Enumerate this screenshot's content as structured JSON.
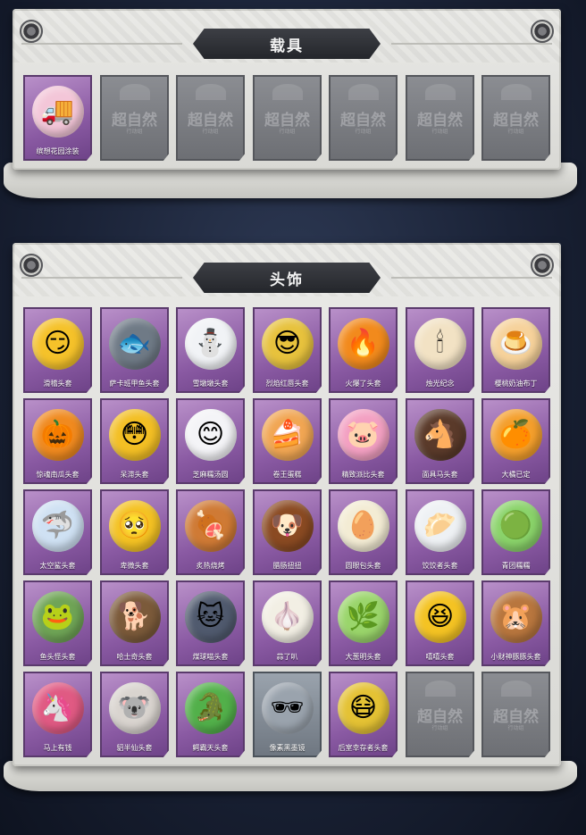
{
  "vehicle_section": {
    "title": "载具",
    "items": [
      {
        "label": "缤想花园涂装",
        "icon": "pink-truck-icon",
        "glyph": "🚚",
        "color": "#f3c6d8"
      }
    ],
    "empty_watermark": "超自然",
    "empty_sub": "行动组",
    "empty_slots": 6
  },
  "head_section": {
    "title": "头饰",
    "items": [
      {
        "label": "滑稽头套",
        "icon": "funny-face-icon",
        "glyph": "😏",
        "color": "#f5c22a"
      },
      {
        "label": "萨卡班甲鱼头套",
        "icon": "fish-head-icon",
        "glyph": "🐟",
        "color": "#6f7a86"
      },
      {
        "label": "雪墩墩头套",
        "icon": "snowman-icon",
        "glyph": "⛄",
        "color": "#f1f3f6"
      },
      {
        "label": "烈焰红唇头套",
        "icon": "sunglasses-pikachu-icon",
        "glyph": "😎",
        "color": "#e7c23d"
      },
      {
        "label": "火爆了头套",
        "icon": "fire-spirit-icon",
        "glyph": "🔥",
        "color": "#f28a1c"
      },
      {
        "label": "烛光纪念",
        "icon": "candle-icon",
        "glyph": "🕯",
        "color": "#f2e2c4"
      },
      {
        "label": "樱桃奶油布丁",
        "icon": "pudding-icon",
        "glyph": "🍮",
        "color": "#f6d29b"
      },
      {
        "label": "惊魂南瓜头套",
        "icon": "pumpkin-icon",
        "glyph": "🎃",
        "color": "#f08a1f"
      },
      {
        "label": "呆滞头套",
        "icon": "dazed-face-icon",
        "glyph": "😳",
        "color": "#f3bf24"
      },
      {
        "label": "芝麻糯汤圆",
        "icon": "rice-ball-icon",
        "glyph": "😊",
        "color": "#f4f4f7"
      },
      {
        "label": "卷王蛋糕",
        "icon": "cake-roll-icon",
        "glyph": "🍰",
        "color": "#f1a653"
      },
      {
        "label": "精致派比头套",
        "icon": "pink-pig-icon",
        "glyph": "🐷",
        "color": "#f3a0c2"
      },
      {
        "label": "面具马头套",
        "icon": "horse-head-icon",
        "glyph": "🐴",
        "color": "#5a3a2a"
      },
      {
        "label": "大橘已定",
        "icon": "orange-icon",
        "glyph": "🍊",
        "color": "#f49f2c"
      },
      {
        "label": "太空鲨头套",
        "icon": "shark-icon",
        "glyph": "🦈",
        "color": "#cfe1f3"
      },
      {
        "label": "卑微头套",
        "icon": "humble-face-icon",
        "glyph": "🥺",
        "color": "#f4c223"
      },
      {
        "label": "炙热烧烤",
        "icon": "bbq-icon",
        "glyph": "🍖",
        "color": "#cf7a35"
      },
      {
        "label": "腊肠扭扭",
        "icon": "dachshund-icon",
        "glyph": "🐶",
        "color": "#8a4a22"
      },
      {
        "label": "圆眼包头套",
        "icon": "bun-icon",
        "glyph": "🥚",
        "color": "#f3ecd4"
      },
      {
        "label": "饺饺者头套",
        "icon": "dumpling-icon",
        "glyph": "🥟",
        "color": "#eef1f4"
      },
      {
        "label": "青团糯糯",
        "icon": "green-rice-icon",
        "glyph": "🟢",
        "color": "#8ad36a"
      },
      {
        "label": "鱼头怪头套",
        "icon": "fishman-icon",
        "glyph": "🐸",
        "color": "#6fa456"
      },
      {
        "label": "哈士奇头套",
        "icon": "husky-icon",
        "glyph": "🐕",
        "color": "#7b5a3a"
      },
      {
        "label": "煤球喵头套",
        "icon": "black-cat-icon",
        "glyph": "🐱",
        "color": "#505a6e"
      },
      {
        "label": "蒜了叭",
        "icon": "garlic-icon",
        "glyph": "🧄",
        "color": "#f2efe4"
      },
      {
        "label": "大葱明头套",
        "icon": "green-onion-icon",
        "glyph": "🌿",
        "color": "#9ad56b"
      },
      {
        "label": "嘻嘻头套",
        "icon": "grin-face-icon",
        "glyph": "😆",
        "color": "#f4c323"
      },
      {
        "label": "小财神豚豚头套",
        "icon": "capybara-icon",
        "glyph": "🐹",
        "color": "#b8763e"
      },
      {
        "label": "马上有钱",
        "icon": "pink-horse-icon",
        "glyph": "🦄",
        "color": "#e05a83"
      },
      {
        "label": "貂半仙头套",
        "icon": "koala-sunglasses-icon",
        "glyph": "🐨",
        "color": "#d9d4cf"
      },
      {
        "label": "鳄霸天头套",
        "icon": "crocodile-icon",
        "glyph": "🐊",
        "color": "#52b04a"
      },
      {
        "label": "像素黑墨镜",
        "icon": "pixel-sunglasses-icon",
        "glyph": "🕶",
        "color": "#9aa3ad",
        "grey": true
      },
      {
        "label": "后室幸存者头套",
        "icon": "gas-mask-icon",
        "glyph": "😷",
        "color": "#e4c234"
      }
    ],
    "empty_watermark": "超自然",
    "empty_sub": "行动组",
    "empty_slots": 2
  }
}
